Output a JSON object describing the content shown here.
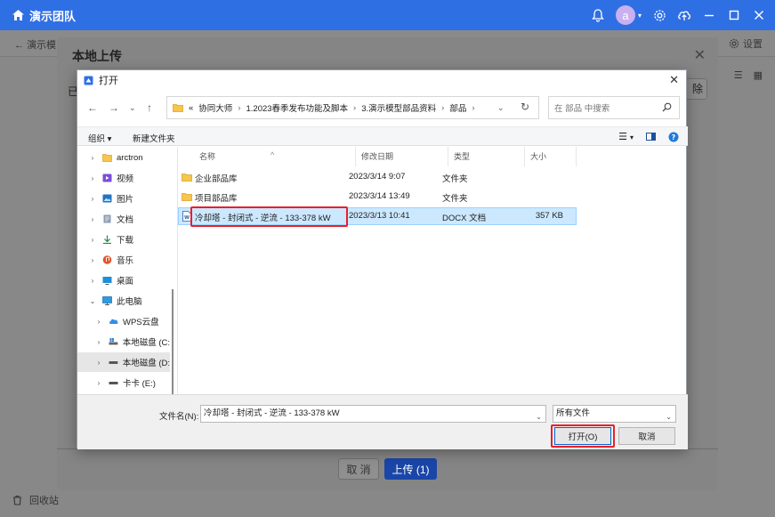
{
  "app": {
    "title": "演示团队",
    "avatar_letter": "a",
    "accent_color": "#2f6fe4"
  },
  "background": {
    "back_label": "演示模",
    "settings_label": "设置",
    "recycle_label": "回收站"
  },
  "upload_modal": {
    "title": "本地上传",
    "left_label": "已",
    "right_button": "除",
    "cancel_label": "取 消",
    "upload_label": "上传 (1)"
  },
  "open_dialog": {
    "title": "打开",
    "breadcrumb": [
      "«",
      "协同大师",
      "1.2023春季发布功能及脚本",
      "3.演示模型部品资料",
      "部品"
    ],
    "search_placeholder": "在 部品 中搜索",
    "organize_label": "组织 ▾",
    "new_folder_label": "新建文件夹",
    "nav_items": [
      {
        "label": "arctron",
        "icon": "folder-icon",
        "expand": "›"
      },
      {
        "label": "视频",
        "icon": "video-icon",
        "expand": "›"
      },
      {
        "label": "图片",
        "icon": "picture-icon",
        "expand": "›"
      },
      {
        "label": "文档",
        "icon": "document-icon",
        "expand": "›"
      },
      {
        "label": "下载",
        "icon": "download-icon",
        "expand": "›"
      },
      {
        "label": "音乐",
        "icon": "music-icon",
        "expand": "›"
      },
      {
        "label": "桌面",
        "icon": "desktop-icon",
        "expand": "›"
      },
      {
        "label": "此电脑",
        "icon": "computer-icon",
        "expand": "⌄"
      },
      {
        "label": "WPS云盘",
        "icon": "cloud-icon",
        "expand": "›"
      },
      {
        "label": "本地磁盘 (C:",
        "icon": "drive-icon",
        "expand": "›"
      },
      {
        "label": "本地磁盘 (D:",
        "icon": "drive-icon",
        "expand": "›"
      },
      {
        "label": "卡卡 (E:)",
        "icon": "drive-icon",
        "expand": "›"
      }
    ],
    "columns": [
      "名称",
      "修改日期",
      "类型",
      "大小"
    ],
    "files": [
      {
        "name": "企业部品库",
        "date": "2023/3/14 9:07",
        "type": "文件夹",
        "size": "",
        "icon": "folder-icon"
      },
      {
        "name": "项目部品库",
        "date": "2023/3/14 13:49",
        "type": "文件夹",
        "size": "",
        "icon": "folder-icon"
      },
      {
        "name": "冷却塔 - 封闭式 - 逆流 - 133-378 kW",
        "date": "2023/3/13 10:41",
        "type": "DOCX 文档",
        "size": "357 KB",
        "icon": "docx-icon"
      }
    ],
    "filename_label": "文件名(N):",
    "filename_value": "冷却塔 - 封闭式 - 逆流 - 133-378 kW",
    "filetype_value": "所有文件",
    "open_label": "打开(O)",
    "cancel_label": "取消",
    "highlight_color": "#e8202a"
  }
}
